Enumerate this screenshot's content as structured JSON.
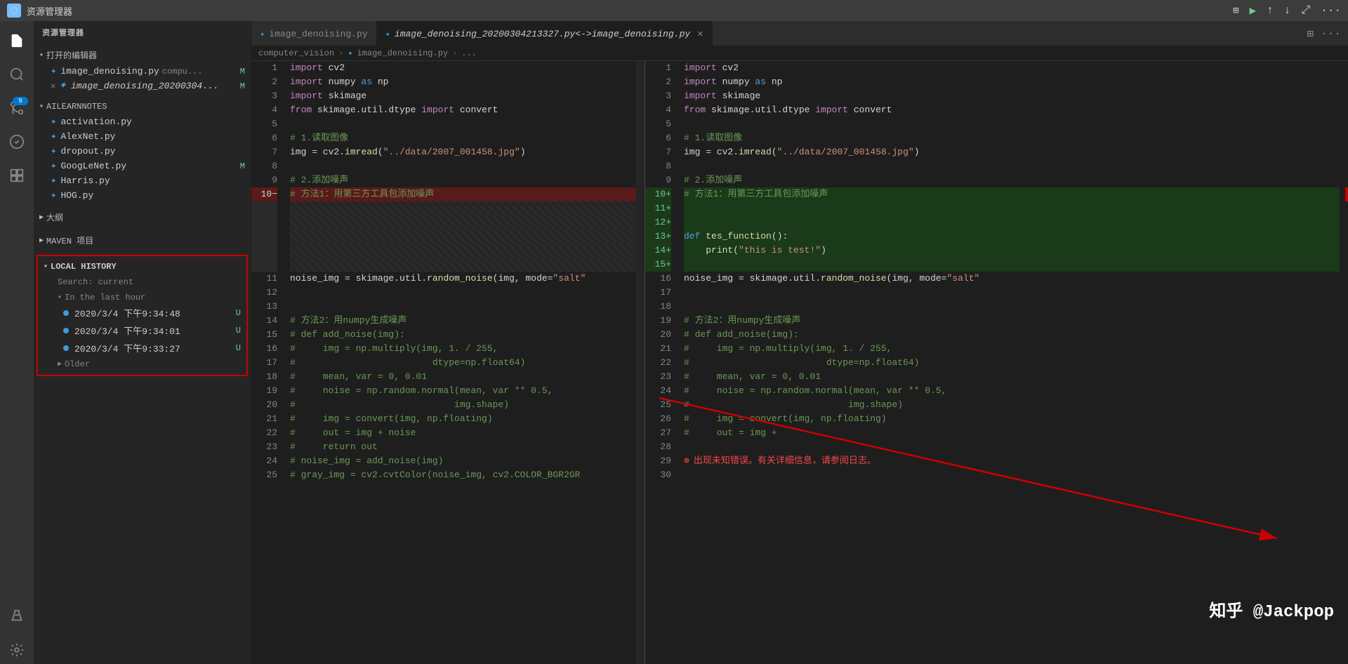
{
  "titlebar": {
    "icon": "◻",
    "title": "资源管理器"
  },
  "sidebar": {
    "title": "资源管理器",
    "open_editors_label": "打开的编辑器",
    "open_files": [
      {
        "name": "image_denoising.py",
        "suffix": "compu...",
        "badge": "M",
        "active": true
      },
      {
        "name": "image_denoising_20200304...",
        "badge": "M",
        "close": true
      }
    ],
    "ailearnnotes_label": "AILEARNNOTES",
    "files": [
      "activation.py",
      "AlexNet.py",
      "dropout.py",
      "GoogLeNet.py",
      "Harris.py",
      "HOG.py"
    ],
    "googelenet_badge": "M",
    "outline_label": "大纲",
    "maven_label": "MAVEN 项目",
    "local_history": {
      "label": "LOCAL HISTORY",
      "search_text": "Search: current",
      "in_last_hour": "In the last hour",
      "items": [
        {
          "time": "2020/3/4 下午9:34:48",
          "badge": "U"
        },
        {
          "time": "2020/3/4 下午9:34:01",
          "badge": "U"
        },
        {
          "time": "2020/3/4 下午9:33:27",
          "badge": "U"
        }
      ],
      "older_label": "Older"
    }
  },
  "tabs": [
    {
      "label": "image_denoising.py",
      "active": false,
      "closeable": false
    },
    {
      "label": "image_denoising_20200304213327.py<->image_denoising.py",
      "active": true,
      "closeable": true,
      "italic": true
    }
  ],
  "breadcrumb": {
    "parts": [
      "computer_vision",
      "image_denoising.py",
      "..."
    ]
  },
  "left_editor": {
    "lines": [
      {
        "num": 1,
        "code": "import cv2",
        "type": "normal"
      },
      {
        "num": 2,
        "code": "import numpy as np",
        "type": "normal"
      },
      {
        "num": 3,
        "code": "import skimage",
        "type": "normal"
      },
      {
        "num": 4,
        "code": "from skimage.util.dtype import convert",
        "type": "normal"
      },
      {
        "num": 5,
        "code": "",
        "type": "normal"
      },
      {
        "num": 6,
        "code": "# 1.读取图像",
        "type": "normal"
      },
      {
        "num": 7,
        "code": "img = cv2.imread(\"../data/2007_001458.jpg\")",
        "type": "normal"
      },
      {
        "num": 8,
        "code": "",
        "type": "normal"
      },
      {
        "num": 9,
        "code": "# 2.添加噪声",
        "type": "normal"
      },
      {
        "num": 10,
        "code": "# 方法1：用第三方工具包添加噪声",
        "type": "deleted"
      },
      {
        "num": "",
        "code": "",
        "type": "striped"
      },
      {
        "num": "",
        "code": "",
        "type": "striped"
      },
      {
        "num": "",
        "code": "",
        "type": "striped"
      },
      {
        "num": "",
        "code": "",
        "type": "striped"
      },
      {
        "num": "",
        "code": "",
        "type": "striped"
      },
      {
        "num": 11,
        "code": "noise_img = skimage.util.random_noise(img, mode=\"salt\"",
        "type": "normal"
      },
      {
        "num": 12,
        "code": "",
        "type": "normal"
      },
      {
        "num": 13,
        "code": "",
        "type": "normal"
      },
      {
        "num": 14,
        "code": "# 方法2：用numpy生成噪声",
        "type": "normal"
      },
      {
        "num": 15,
        "code": "# def add_noise(img):",
        "type": "normal"
      },
      {
        "num": 16,
        "code": "#     img = np.multiply(img, 1. / 255,",
        "type": "normal"
      },
      {
        "num": 17,
        "code": "#                         dtype=np.float64)",
        "type": "normal"
      },
      {
        "num": 18,
        "code": "#     mean, var = 0, 0.01",
        "type": "normal"
      },
      {
        "num": 19,
        "code": "#     noise = np.random.normal(mean, var ** 0.5,",
        "type": "normal"
      },
      {
        "num": 20,
        "code": "#                             img.shape)",
        "type": "normal"
      },
      {
        "num": 21,
        "code": "#     img = convert(img, np.floating)",
        "type": "normal"
      },
      {
        "num": 22,
        "code": "#     out = img + noise",
        "type": "normal"
      },
      {
        "num": 23,
        "code": "#     return out",
        "type": "normal"
      },
      {
        "num": 24,
        "code": "# noise_img = add_noise(img)",
        "type": "normal"
      },
      {
        "num": 25,
        "code": "# gray_img = cv2.cvtColor(noise_img, cv2.COLOR_BGR2GR",
        "type": "normal"
      }
    ]
  },
  "right_editor": {
    "lines": [
      {
        "num": 1,
        "code": "import cv2",
        "type": "normal"
      },
      {
        "num": 2,
        "code": "import numpy as np",
        "type": "normal"
      },
      {
        "num": 3,
        "code": "import skimage",
        "type": "normal"
      },
      {
        "num": 4,
        "code": "from skimage.util.dtype import convert",
        "type": "normal"
      },
      {
        "num": 5,
        "code": "",
        "type": "normal"
      },
      {
        "num": 6,
        "code": "# 1.读取图像",
        "type": "normal"
      },
      {
        "num": 7,
        "code": "img = cv2.imread(\"../data/2007_001458.jpg\")",
        "type": "normal"
      },
      {
        "num": 8,
        "code": "",
        "type": "normal"
      },
      {
        "num": 9,
        "code": "# 2.添加噪声",
        "type": "normal"
      },
      {
        "num": "10+",
        "code": "# 方法1：用第三方工具包添加噪声",
        "type": "added"
      },
      {
        "num": "11+",
        "code": "",
        "type": "added"
      },
      {
        "num": "12+",
        "code": "",
        "type": "added"
      },
      {
        "num": "13+",
        "code": "def tes_function():",
        "type": "added"
      },
      {
        "num": "14+",
        "code": "    print(\"this is test!\")",
        "type": "added"
      },
      {
        "num": "15+",
        "code": "",
        "type": "added"
      },
      {
        "num": 16,
        "code": "noise_img = skimage.util.random_noise(img, mode=\"salt\"",
        "type": "normal"
      },
      {
        "num": 17,
        "code": "",
        "type": "normal"
      },
      {
        "num": 18,
        "code": "",
        "type": "normal"
      },
      {
        "num": 19,
        "code": "# 方法2：用numpy生成噪声",
        "type": "normal"
      },
      {
        "num": 20,
        "code": "# def add_noise(img):",
        "type": "normal"
      },
      {
        "num": 21,
        "code": "#     img = np.multiply(img, 1. / 255,",
        "type": "normal"
      },
      {
        "num": 22,
        "code": "#                         dtype=np.float64)",
        "type": "normal"
      },
      {
        "num": 23,
        "code": "#     mean, var = 0, 0.01",
        "type": "normal"
      },
      {
        "num": 24,
        "code": "#     noise = np.random.normal(mean, var ** 0.5,",
        "type": "normal"
      },
      {
        "num": 25,
        "code": "#                             img.shape)",
        "type": "normal"
      },
      {
        "num": 26,
        "code": "#     img = convert(img, np.floating)",
        "type": "normal"
      },
      {
        "num": 27,
        "code": "#     out = img +",
        "type": "normal"
      },
      {
        "num": 28,
        "code": "",
        "type": "normal"
      },
      {
        "num": 29,
        "code": "出现未知错误。有关详细信息，请参阅日志。",
        "type": "normal"
      },
      {
        "num": 30,
        "code": "",
        "type": "normal"
      }
    ]
  },
  "watermark": "知乎 @Jackpop",
  "error_text": "出现未知错误。有关详细信息，请参阅日志。"
}
